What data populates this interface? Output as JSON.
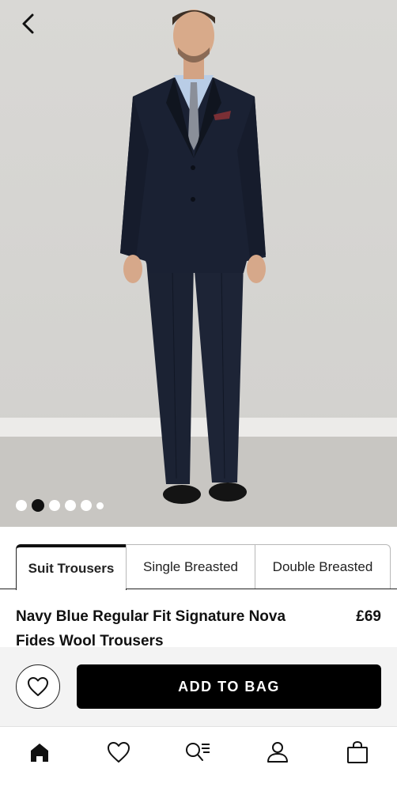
{
  "product": {
    "image_dots": {
      "count": 6,
      "active_index": 1
    },
    "title": "Navy Blue Regular Fit Signature Nova Fides Wool Trousers",
    "price": "£69"
  },
  "tabs": [
    {
      "label": "Suit Trousers",
      "active": true
    },
    {
      "label": "Single Breasted",
      "active": false
    },
    {
      "label": "Double Breasted",
      "active": false
    }
  ],
  "actions": {
    "add_to_bag": "ADD TO BAG",
    "wishlist_icon": "heart-icon"
  },
  "bottom_nav": [
    {
      "icon": "home-icon",
      "active": true
    },
    {
      "icon": "heart-icon",
      "active": false
    },
    {
      "icon": "search-list-icon",
      "active": false
    },
    {
      "icon": "account-icon",
      "active": false
    },
    {
      "icon": "bag-icon",
      "active": false
    }
  ]
}
